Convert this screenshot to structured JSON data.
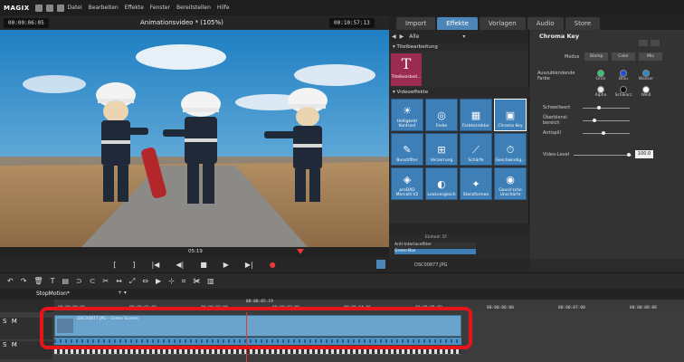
{
  "menubar": {
    "logo": "MAGIX",
    "items": [
      "Datei",
      "Bearbeiten",
      "Effekte",
      "Fenster",
      "Bereitstellen",
      "Hilfe"
    ]
  },
  "preview": {
    "timecode_left": "00:00:06:05",
    "title": "Animationsvideo * (105%)",
    "timecode_right": "00:10:57:13",
    "scrub_time": "05:19"
  },
  "tabs": [
    "Import",
    "Effekte",
    "Vorlagen",
    "Audio",
    "Store"
  ],
  "active_tab": "Effekte",
  "fx": {
    "filter": "Alle",
    "section_title": "Titelbearbeitung",
    "title_tile": "Titelbearbeit...",
    "section_video": "Videoeffekte",
    "tiles": [
      "Helligkeit/ Kontrast",
      "Farbe",
      "Farbkorrektur",
      "Chroma Key",
      "Bunstifiter",
      "Verzerrung",
      "Schärfe",
      "Geschwindig...",
      "proDAD Mercalli V2",
      "Lookvergleich",
      "Stanzformen",
      "Gauss'sche Unschärfe"
    ],
    "tile_icons": [
      "☀",
      "◎",
      "▦",
      "▣",
      "✎",
      "⊞",
      "⟋",
      "⏱",
      "◈",
      "◐",
      "✦",
      "◉"
    ],
    "selected_tile": "Chroma Key",
    "einheit_label": "Einheit: 1F",
    "effect_list": [
      "Anti-Interlacefilter",
      "Green-Box"
    ],
    "file_name": "DSC00877.JPG"
  },
  "chroma": {
    "title": "Chroma Key",
    "modus_label": "Modus",
    "modus_options": [
      "Stamp",
      "Color",
      "Mix"
    ],
    "colors_label": "Auszublendende Farbe",
    "colors": [
      {
        "name": "Grün",
        "hex": "#2ecc71"
      },
      {
        "name": "Blau",
        "hex": "#1f4fd8"
      },
      {
        "name": "Wasser",
        "hex": "#2f86c9"
      },
      {
        "name": "Alpha",
        "hex": "#e8e8e8"
      },
      {
        "name": "Schwarz",
        "hex": "#111111"
      },
      {
        "name": "Weiß",
        "hex": "#ffffff"
      }
    ],
    "schwellwert_label": "Schwellwert",
    "ueberblend_label": "Überblend-bereich",
    "antispill_label": "Antispill",
    "videolevel_label": "Video-Level",
    "videolevel_value": "100.0",
    "schwellwert": 0.35,
    "ueberblend": 0.25,
    "antispill": 0.45,
    "videolevel": 0.95
  },
  "transport": {
    "buttons": [
      "[",
      "]",
      "|◀",
      "◀|",
      "■",
      "▶",
      "▶|",
      "●"
    ]
  },
  "toolbar": {
    "tools": [
      "↶",
      "↷",
      "🗑",
      "T",
      "▤",
      "⊃",
      "⊂",
      "✂",
      "↔",
      "⤢",
      "⇔",
      "▶",
      "⊹",
      "⌗",
      "✀",
      "▥"
    ]
  },
  "project": {
    "name": "StopMotion*"
  },
  "timeline": {
    "playhead": "00:00:05:19",
    "ticks": [
      "00:00:00:00",
      "00:00:01:00",
      "00:00:02:00",
      "00:00:03:00",
      "00:00:04:00",
      "00:00:05:00",
      "00:00:06:00",
      "00:00:07:00",
      "00:00:08:00"
    ],
    "track_labels": [
      "S",
      "M",
      "S",
      "M"
    ],
    "clip_label": "DSC00877.JPG - Green Screen"
  },
  "colors": {
    "accent": "#4c86b8",
    "tile": "#3d7fb6",
    "highlight": "#e8141b",
    "record": "#e53935",
    "playhead": "#e53935"
  }
}
